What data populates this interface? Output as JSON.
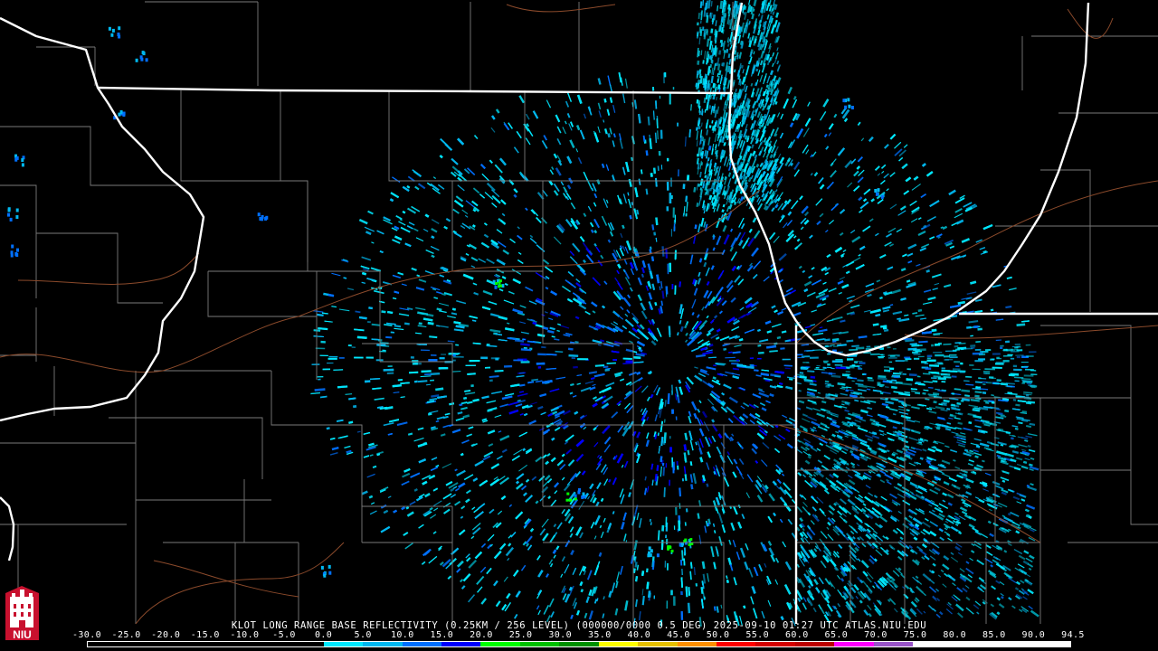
{
  "title": "KLOT LONG RANGE BASE REFLECTIVITY (0.25KM / 256 LEVEL) (000000/0000 0.5 DEG) 2025-09-10 01:27 UTC  ATLAS.NIU.EDU",
  "radar": {
    "site": "KLOT",
    "product": "LONG RANGE BASE REFLECTIVITY",
    "resolution": "0.25KM / 256 LEVEL",
    "elevation": "0.5 DEG",
    "datetime": "2025-09-10 01:27 UTC",
    "source": "ATLAS.NIU.EDU"
  },
  "legend": {
    "units_note": "",
    "ticks": [
      "-30.0",
      "-25.0",
      "-20.0",
      "-15.0",
      "-10.0",
      "-5.0",
      "0.0",
      "5.0",
      "10.0",
      "15.0",
      "20.0",
      "25.0",
      "30.0",
      "35.0",
      "40.0",
      "45.0",
      "50.0",
      "55.0",
      "60.0",
      "65.0",
      "70.0",
      "75.0",
      "80.0",
      "85.0",
      "90.0",
      "94.5"
    ],
    "colors": [
      "#000000",
      "#000000",
      "#000000",
      "#000000",
      "#000000",
      "#000000",
      "#00e8ff",
      "#00b8f0",
      "#0070ff",
      "#0000ff",
      "#00ff00",
      "#00c000",
      "#009000",
      "#ffff00",
      "#e6c000",
      "#ff9000",
      "#ff0000",
      "#d40000",
      "#bc0000",
      "#ff00ff",
      "#9955c9",
      "#ffffff",
      "#ffffff",
      "#ffffff",
      "#ffffff"
    ]
  },
  "logo": {
    "text": "NIU",
    "color": "#c8102e"
  },
  "map": {
    "background": "#000000",
    "state_line_color": "#ffffff",
    "county_line_color": "#7a7a7a",
    "road_color": "#8b4a2b",
    "echo_colors": [
      "#00e8ff",
      "#00b8f0",
      "#0070ff",
      "#0000ff",
      "#00ff00"
    ]
  }
}
